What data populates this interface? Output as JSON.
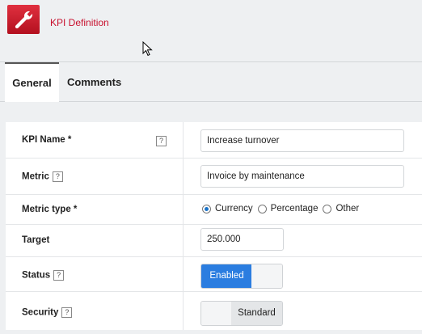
{
  "header": {
    "title": "KPI Definition",
    "icon": "wrench-icon",
    "accent": "#c8102e"
  },
  "tabs": [
    {
      "label": "General",
      "active": true
    },
    {
      "label": "Comments",
      "active": false
    }
  ],
  "form": {
    "kpi_name": {
      "label": "KPI Name *",
      "value": "Increase turnover"
    },
    "metric": {
      "label": "Metric",
      "value": "Invoice by maintenance"
    },
    "metric_type": {
      "label": "Metric type *",
      "options": [
        "Currency",
        "Percentage",
        "Other"
      ],
      "selected": "Currency"
    },
    "target": {
      "label": "Target",
      "value": "250.000"
    },
    "status": {
      "label": "Status",
      "value": "Enabled"
    },
    "security": {
      "label": "Security",
      "value": "Standard"
    },
    "help_glyph": "?"
  },
  "colors": {
    "toggle_on": "#2b7de0",
    "radio_checked": "#1a73c8"
  }
}
